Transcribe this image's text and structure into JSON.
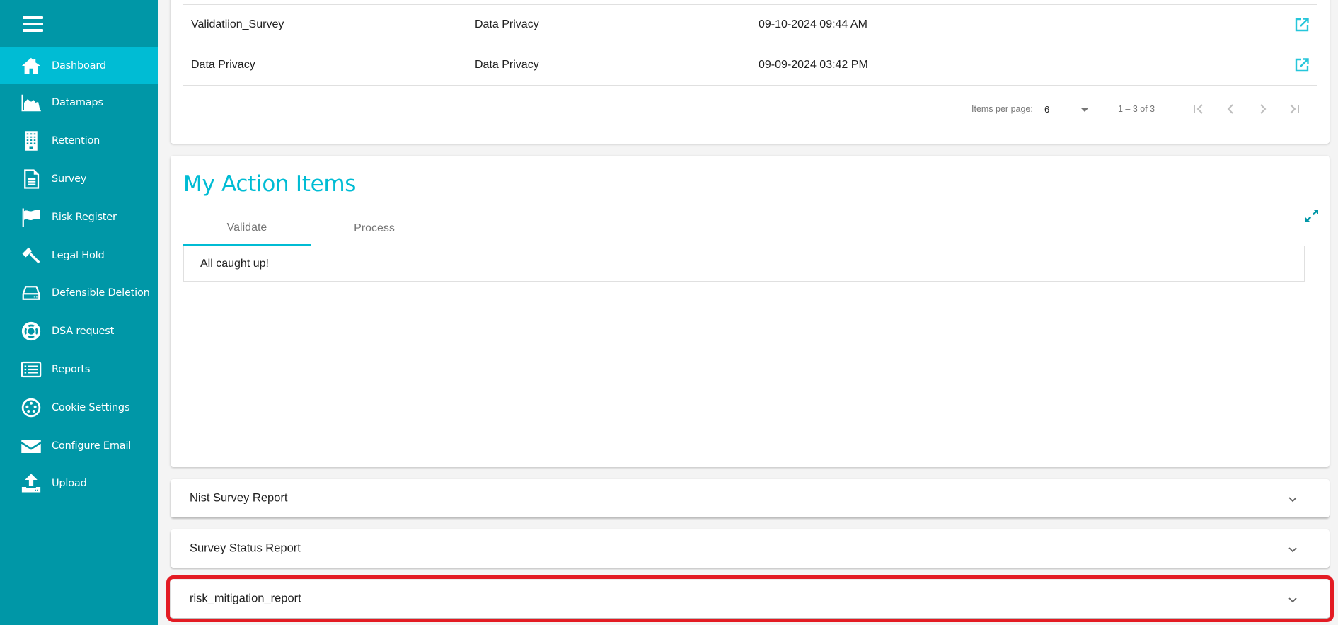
{
  "sidebar": {
    "menu_icon": "hamburger-menu-icon",
    "items": [
      {
        "label": "Dashboard",
        "icon": "home-icon",
        "active": true
      },
      {
        "label": "Datamaps",
        "icon": "area-chart-icon"
      },
      {
        "label": "Retention",
        "icon": "building-icon"
      },
      {
        "label": "Survey",
        "icon": "document-icon"
      },
      {
        "label": "Risk Register",
        "icon": "flag-icon"
      },
      {
        "label": "Legal Hold",
        "icon": "gavel-icon"
      },
      {
        "label": "Defensible Deletion",
        "icon": "hard-drive-icon"
      },
      {
        "label": "DSA request",
        "icon": "life-ring-icon"
      },
      {
        "label": "Reports",
        "icon": "list-icon"
      },
      {
        "label": "Cookie Settings",
        "icon": "cookie-icon"
      },
      {
        "label": "Configure Email",
        "icon": "envelope-icon"
      },
      {
        "label": "Upload",
        "icon": "upload-icon"
      }
    ]
  },
  "survey_table": {
    "rows": [
      {
        "name": "Validatiion_Survey",
        "category": "Data Privacy",
        "date": "09-10-2024 09:44 AM",
        "action_icon": "open-in-new-icon"
      },
      {
        "name": "Data Privacy",
        "category": "Data Privacy",
        "date": "09-09-2024 03:42 PM",
        "action_icon": "open-in-new-icon"
      }
    ],
    "paginator": {
      "items_per_page_label": "Items per page:",
      "items_per_page_value": "6",
      "range_label": "1 – 3 of 3"
    }
  },
  "action_items": {
    "title": "My Action Items",
    "tabs": [
      {
        "label": "Validate",
        "active": true
      },
      {
        "label": "Process",
        "active": false
      }
    ],
    "empty_message": "All caught up!"
  },
  "report_panels": [
    {
      "title": "Nist Survey Report"
    },
    {
      "title": "Survey Status Report"
    },
    {
      "title": "risk_mitigation_report",
      "highlighted": true
    }
  ],
  "colors": {
    "sidebar": "#0097a7",
    "sidebar_active": "#00bcd4",
    "accent": "#00bcd4",
    "highlight": "#e31b23"
  }
}
